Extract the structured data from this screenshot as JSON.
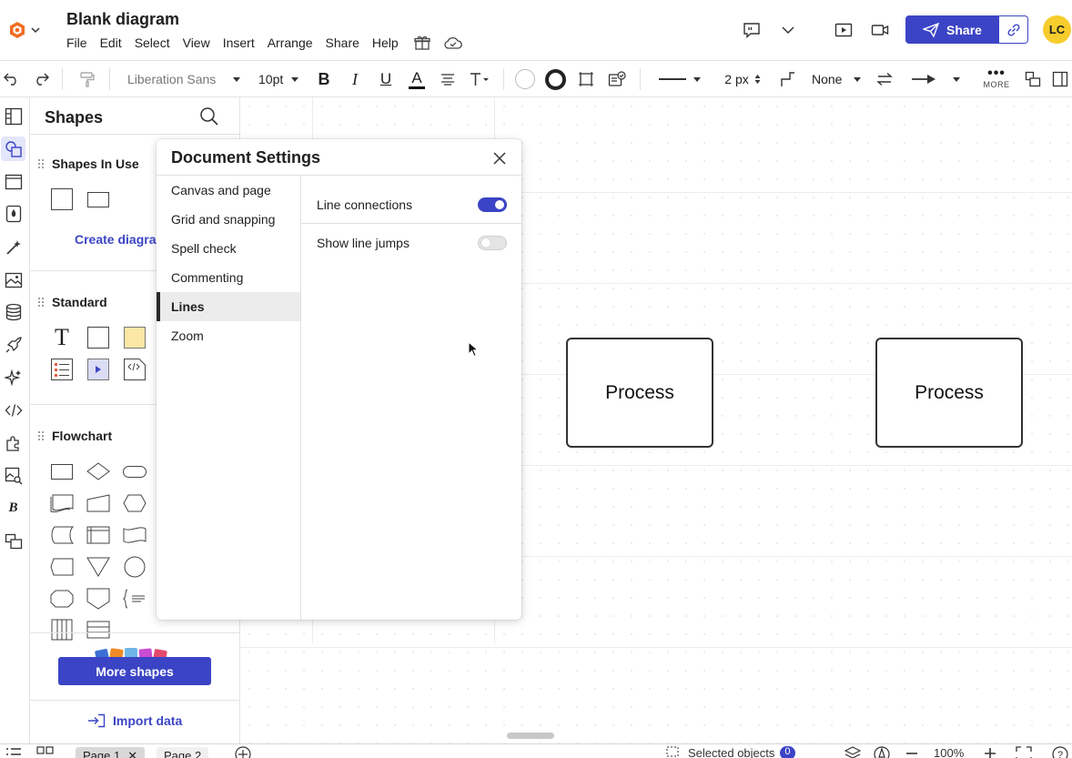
{
  "app": {
    "doc_title": "Blank diagram",
    "menu": [
      "File",
      "Edit",
      "Select",
      "View",
      "Insert",
      "Arrange",
      "Share",
      "Help"
    ],
    "share_label": "Share",
    "avatar_initials": "LC",
    "accent_color": "#3b44c5"
  },
  "toolbar": {
    "font_family": "Liberation Sans",
    "font_size": "10pt",
    "line_width": "2 px",
    "endpoint_style": "None",
    "more_label": "MORE"
  },
  "shapes_panel": {
    "title": "Shapes",
    "sections": {
      "in_use": "Shapes In Use",
      "standard": "Standard",
      "flowchart": "Flowchart"
    },
    "create_link": "Create diagram",
    "more_shapes": "More shapes",
    "import_data": "Import data"
  },
  "canvas": {
    "shapes": [
      {
        "label": "Process"
      },
      {
        "label": "Process"
      }
    ]
  },
  "dialog": {
    "title": "Document Settings",
    "nav": [
      "Canvas and page",
      "Grid and snapping",
      "Spell check",
      "Commenting",
      "Lines",
      "Zoom"
    ],
    "active_nav": "Lines",
    "settings": [
      {
        "label": "Line connections",
        "enabled": true
      },
      {
        "label": "Show line jumps",
        "enabled": false
      }
    ]
  },
  "bottom": {
    "pages": [
      "Page 1",
      "Page 2"
    ],
    "active_page": "Page 1",
    "selected_objects_label": "Selected objects",
    "selected_count": "0",
    "zoom": "100%"
  }
}
